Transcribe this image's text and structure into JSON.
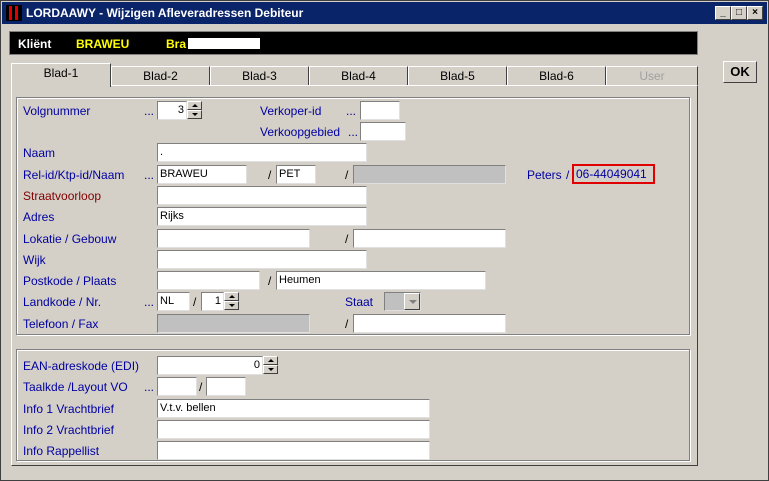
{
  "window": {
    "title": "LORDAAWY - Wijzigen Afleveradressen Debiteur",
    "buttons": {
      "minimize": "_",
      "maximize": "□",
      "close": "×"
    }
  },
  "client": {
    "label": "Kliënt",
    "code": "BRAWEU",
    "name": "Bra"
  },
  "tabs": [
    {
      "label": "Blad-1",
      "active": true
    },
    {
      "label": "Blad-2"
    },
    {
      "label": "Blad-3"
    },
    {
      "label": "Blad-4"
    },
    {
      "label": "Blad-5"
    },
    {
      "label": "Blad-6"
    },
    {
      "label": "User",
      "disabled": true
    }
  ],
  "ok_label": "OK",
  "form": {
    "volgnummer": {
      "label": "Volgnummer",
      "dots": "...",
      "value": "3"
    },
    "verkoper": {
      "label": "Verkoper-id",
      "dots": "...",
      "value": ""
    },
    "verkoopgebied": {
      "label": "Verkoopgebied",
      "dots": "...",
      "value": ""
    },
    "naam": {
      "label": "Naam",
      "value": "."
    },
    "relid": {
      "label": "Rel-id/Ktp-id/Naam",
      "dots": "...",
      "value": "BRAWEU",
      "ktp": "PET",
      "naam": ""
    },
    "contact": {
      "name": "Peters",
      "slash": "/",
      "phone": "06-44049041"
    },
    "straatvoorloop": {
      "label": "Straatvoorloop",
      "value": ""
    },
    "adres": {
      "label": "Adres",
      "value": "Rijks"
    },
    "lokatie": {
      "label": "Lokatie / Gebouw",
      "value": "",
      "value2": ""
    },
    "wijk": {
      "label": "Wijk",
      "value": ""
    },
    "postkode": {
      "label": "Postkode / Plaats",
      "value": "",
      "plaats": "Heumen"
    },
    "landkode": {
      "label": "Landkode  / Nr.",
      "dots": "...",
      "value": "NL",
      "nr": "1"
    },
    "staat": {
      "label": "Staat",
      "value": ""
    },
    "telefoon": {
      "label": "Telefoon / Fax",
      "value": "",
      "fax": ""
    },
    "slash": "/"
  },
  "form2": {
    "ean": {
      "label": "EAN-adreskode (EDI)",
      "value": "0"
    },
    "taalkde": {
      "label": "Taalkde /Layout VO",
      "dots": "...",
      "value": "",
      "layout": ""
    },
    "info1": {
      "label": "Info 1 Vrachtbrief",
      "value": "V.t.v. bellen"
    },
    "info2": {
      "label": "Info 2 Vrachtbrief",
      "value": ""
    },
    "rappel": {
      "label": "Info Rappellist",
      "value": ""
    }
  },
  "colors": {
    "titlebar": "#0a246a",
    "label": "#0000a0",
    "highlight": "#e00000",
    "client_text": "#ffff00"
  }
}
